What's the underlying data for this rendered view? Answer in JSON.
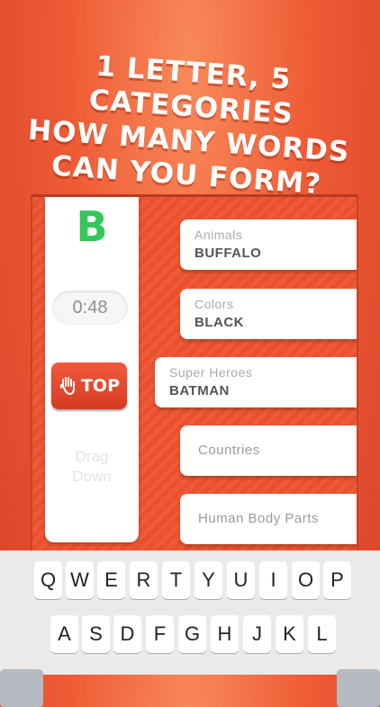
{
  "headline": {
    "line1": "1 letter, 5  categories",
    "line2": "how many words",
    "line3": "can you form?"
  },
  "game": {
    "letter": "B",
    "timer": "0:48",
    "stop_label": "TOP",
    "drag_line1": "Drag",
    "drag_line2": "Down"
  },
  "categories": [
    {
      "name": "Animals",
      "answer": "BUFFALO"
    },
    {
      "name": "Colors",
      "answer": "BLACK"
    },
    {
      "name": "Super Heroes",
      "answer": "BATMAN"
    },
    {
      "name": "Countries",
      "answer": ""
    },
    {
      "name": "Human Body Parts",
      "answer": ""
    }
  ],
  "keyboard": {
    "row1": [
      "Q",
      "W",
      "E",
      "R",
      "T",
      "Y",
      "U",
      "I",
      "O",
      "P"
    ],
    "row2": [
      "A",
      "S",
      "D",
      "F",
      "G",
      "H",
      "J",
      "K",
      "L"
    ]
  },
  "colors": {
    "background": "#ee5b35",
    "letter": "#34c759",
    "stop_button": "#e24a2e"
  },
  "icons": {
    "stop_icon": "raised-hand-icon"
  }
}
